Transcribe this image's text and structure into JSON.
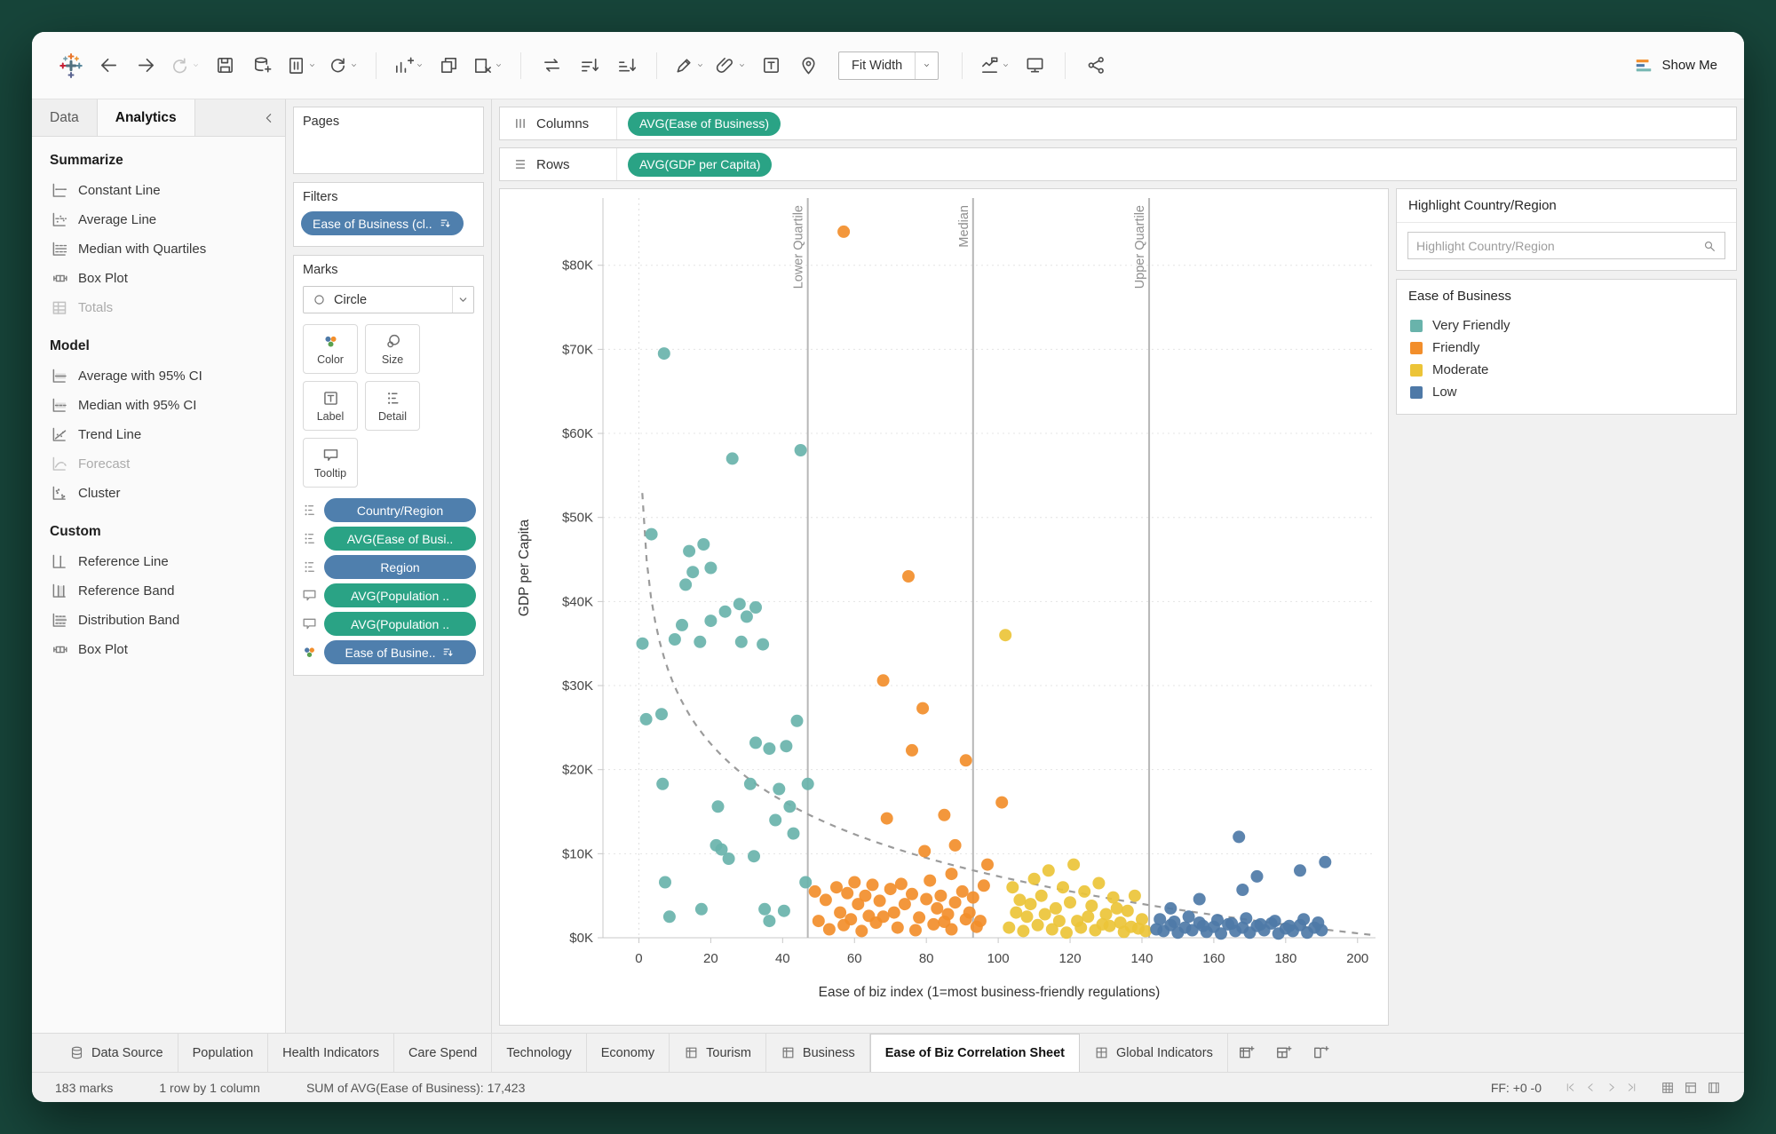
{
  "colors": {
    "desktop": "#17453a",
    "pill_green": "#2aa385",
    "pill_blue": "#4f7fad"
  },
  "toolbar": {
    "fit_label": "Fit Width",
    "show_me_label": "Show Me",
    "items": [
      {
        "type": "btn",
        "icon": "tableau-logo",
        "logo": true
      },
      {
        "type": "btn",
        "icon": "back"
      },
      {
        "type": "btn",
        "icon": "forward"
      },
      {
        "type": "btn",
        "icon": "redo",
        "caret": true,
        "disabled": true
      },
      {
        "type": "btn",
        "icon": "save"
      },
      {
        "type": "btn",
        "icon": "add-data"
      },
      {
        "type": "btn",
        "icon": "pause-updates",
        "caret": true
      },
      {
        "type": "btn",
        "icon": "refresh",
        "caret": true
      },
      {
        "type": "sep"
      },
      {
        "type": "btn",
        "icon": "new-sheet",
        "caret": true
      },
      {
        "type": "btn",
        "icon": "duplicate"
      },
      {
        "type": "btn",
        "icon": "clear-sheet",
        "caret": true
      },
      {
        "type": "sep"
      },
      {
        "type": "btn",
        "icon": "swap-axes"
      },
      {
        "type": "btn",
        "icon": "sort-asc"
      },
      {
        "type": "btn",
        "icon": "sort-desc"
      },
      {
        "type": "sep"
      },
      {
        "type": "btn",
        "icon": "highlight",
        "caret": true
      },
      {
        "type": "btn",
        "icon": "group-members",
        "caret": true
      },
      {
        "type": "btn",
        "icon": "show-labels"
      },
      {
        "type": "btn",
        "icon": "pin"
      },
      {
        "type": "fit"
      },
      {
        "type": "sep"
      },
      {
        "type": "btn",
        "icon": "chart-labels",
        "caret": true
      },
      {
        "type": "btn",
        "icon": "presentation"
      },
      {
        "type": "sep"
      },
      {
        "type": "btn",
        "icon": "share"
      }
    ]
  },
  "left_panel": {
    "tabs": [
      {
        "label": "Data"
      },
      {
        "label": "Analytics"
      }
    ],
    "active_tab": "Analytics",
    "sections": [
      {
        "title": "Summarize",
        "items": [
          {
            "label": "Constant Line",
            "icon": "constant-line"
          },
          {
            "label": "Average Line",
            "icon": "average-line"
          },
          {
            "label": "Median with Quartiles",
            "icon": "median-quartiles"
          },
          {
            "label": "Box Plot",
            "icon": "box-plot"
          },
          {
            "label": "Totals",
            "icon": "totals",
            "disabled": true
          }
        ]
      },
      {
        "title": "Model",
        "items": [
          {
            "label": "Average with 95% CI",
            "icon": "average-ci"
          },
          {
            "label": "Median with 95% CI",
            "icon": "median-ci"
          },
          {
            "label": "Trend Line",
            "icon": "trend-line"
          },
          {
            "label": "Forecast",
            "icon": "forecast",
            "disabled": true
          },
          {
            "label": "Cluster",
            "icon": "cluster"
          }
        ]
      },
      {
        "title": "Custom",
        "items": [
          {
            "label": "Reference Line",
            "icon": "reference-line"
          },
          {
            "label": "Reference Band",
            "icon": "reference-band"
          },
          {
            "label": "Distribution Band",
            "icon": "distribution-band"
          },
          {
            "label": "Box Plot",
            "icon": "box-plot"
          }
        ]
      }
    ]
  },
  "shelves": {
    "pages_label": "Pages",
    "filters_label": "Filters",
    "filter_pills": [
      {
        "label": "Ease of Business (cl..",
        "color": "blue",
        "trailing_icon": "legend"
      }
    ],
    "marks_label": "Marks",
    "mark_type": "Circle",
    "mark_buttons": [
      {
        "label": "Color",
        "icon": "color"
      },
      {
        "label": "Size",
        "icon": "size"
      },
      {
        "label": "Label",
        "icon": "label"
      },
      {
        "label": "Detail",
        "icon": "detail"
      },
      {
        "label": "Tooltip",
        "icon": "tooltip"
      }
    ],
    "mark_pills": [
      {
        "label": "Country/Region",
        "color": "blue",
        "icon": "detail"
      },
      {
        "label": "AVG(Ease of Busi..",
        "color": "green",
        "icon": "detail"
      },
      {
        "label": "Region",
        "color": "blue",
        "icon": "detail"
      },
      {
        "label": "AVG(Population ..",
        "color": "green",
        "icon": "tooltip"
      },
      {
        "label": "AVG(Population ..",
        "color": "green",
        "icon": "tooltip"
      },
      {
        "label": "Ease of Busine..",
        "color": "blue",
        "icon": "color",
        "trailing_icon": "legend"
      }
    ],
    "columns_label": "Columns",
    "columns_pills": [
      {
        "label": "AVG(Ease of Business)",
        "color": "green"
      }
    ],
    "rows_label": "Rows",
    "rows_pills": [
      {
        "label": "AVG(GDP per Capita)",
        "color": "green"
      }
    ]
  },
  "chart_data": {
    "type": "scatter",
    "title": "",
    "xlabel": "Ease of biz index (1=most business-friendly regulations)",
    "ylabel": "GDP per Capita",
    "xlim": [
      -10,
      205
    ],
    "ylim": [
      0,
      88
    ],
    "x_ticks": [
      0,
      20,
      40,
      60,
      80,
      100,
      120,
      140,
      160,
      180,
      200
    ],
    "y_ticks": [
      0,
      10,
      20,
      30,
      40,
      50,
      60,
      70,
      80
    ],
    "y_tick_labels": [
      "$0K",
      "$10K",
      "$20K",
      "$30K",
      "$40K",
      "$50K",
      "$60K",
      "$70K",
      "$80K"
    ],
    "grid": "dotted-horizontal",
    "total_marks": 183,
    "reference_lines": [
      {
        "x": 47,
        "label": "Lower Quartile"
      },
      {
        "x": 93,
        "label": "Median"
      },
      {
        "x": 142,
        "label": "Upper Quartile"
      }
    ],
    "trend_line": {
      "style": "dashed",
      "model": "y = 52.4 - 9.79*ln(x)",
      "a": 52.4,
      "b": -9.79,
      "x_start": 0.95,
      "x_end": 204
    },
    "series": [
      {
        "name": "Very Friendly",
        "color": "#69b3ab",
        "points": [
          [
            7,
            69.5
          ],
          [
            26,
            57
          ],
          [
            45,
            58
          ],
          [
            3.5,
            48
          ],
          [
            14,
            46
          ],
          [
            15,
            43.5
          ],
          [
            13,
            42
          ],
          [
            20,
            44
          ],
          [
            1,
            35
          ],
          [
            10,
            35.5
          ],
          [
            17,
            35.2
          ],
          [
            20,
            37.7
          ],
          [
            24,
            38.8
          ],
          [
            28,
            39.7
          ],
          [
            30,
            38.2
          ],
          [
            32.5,
            39.3
          ],
          [
            28.5,
            35.2
          ],
          [
            34.5,
            34.9
          ],
          [
            6.3,
            26.6
          ],
          [
            2,
            26
          ],
          [
            6.6,
            18.3
          ],
          [
            32.5,
            23.2
          ],
          [
            36.3,
            22.5
          ],
          [
            31,
            18.3
          ],
          [
            39,
            17.7
          ],
          [
            47,
            18.3
          ],
          [
            22,
            15.6
          ],
          [
            42,
            15.6
          ],
          [
            43,
            12.4
          ],
          [
            21.5,
            11
          ],
          [
            25,
            9.4
          ],
          [
            32,
            9.7
          ],
          [
            7.3,
            6.6
          ],
          [
            17.4,
            3.4
          ],
          [
            8.5,
            2.5
          ],
          [
            35,
            3.4
          ],
          [
            40.4,
            3.2
          ],
          [
            36.3,
            2
          ],
          [
            46.4,
            6.6
          ],
          [
            23,
            10.5
          ],
          [
            38,
            14
          ],
          [
            44,
            25.8
          ],
          [
            41,
            22.8
          ],
          [
            12,
            37.2
          ],
          [
            18,
            46.8
          ]
        ]
      },
      {
        "name": "Friendly",
        "color": "#f28e2b",
        "points": [
          [
            57,
            84
          ],
          [
            75,
            43
          ],
          [
            68,
            30.6
          ],
          [
            79,
            27.3
          ],
          [
            76,
            22.3
          ],
          [
            91,
            21.1
          ],
          [
            85,
            14.6
          ],
          [
            101,
            16.1
          ],
          [
            69,
            14.2
          ],
          [
            79.5,
            10.3
          ],
          [
            88,
            11
          ],
          [
            97,
            8.7
          ],
          [
            87,
            7.6
          ],
          [
            49,
            5.5
          ],
          [
            52,
            4.5
          ],
          [
            55,
            6
          ],
          [
            56,
            3
          ],
          [
            58,
            5.3
          ],
          [
            60,
            6.6
          ],
          [
            61,
            4
          ],
          [
            63,
            5
          ],
          [
            64,
            2.6
          ],
          [
            65,
            6.3
          ],
          [
            67,
            4.4
          ],
          [
            70,
            5.8
          ],
          [
            71,
            3
          ],
          [
            73,
            6.4
          ],
          [
            74,
            4
          ],
          [
            76,
            5.2
          ],
          [
            78,
            2.4
          ],
          [
            80,
            4.6
          ],
          [
            81,
            6.8
          ],
          [
            83,
            3.5
          ],
          [
            84,
            5
          ],
          [
            86,
            2.8
          ],
          [
            88,
            4.2
          ],
          [
            90,
            5.5
          ],
          [
            92,
            3
          ],
          [
            93,
            4.8
          ],
          [
            95,
            2
          ],
          [
            50,
            2
          ],
          [
            53,
            1
          ],
          [
            57,
            1.5
          ],
          [
            62,
            0.8
          ],
          [
            66,
            1.8
          ],
          [
            72,
            1.2
          ],
          [
            77,
            0.9
          ],
          [
            82,
            1.6
          ],
          [
            87,
            1
          ],
          [
            91,
            2.2
          ],
          [
            94,
            1.3
          ],
          [
            59,
            2.2
          ],
          [
            68,
            2.5
          ],
          [
            85,
            1.9
          ],
          [
            96,
            6.2
          ]
        ]
      },
      {
        "name": "Moderate",
        "color": "#ecc438",
        "points": [
          [
            102,
            36
          ],
          [
            104,
            6
          ],
          [
            106,
            4.5
          ],
          [
            108,
            2.5
          ],
          [
            110,
            7
          ],
          [
            112,
            5
          ],
          [
            114,
            8
          ],
          [
            116,
            3.5
          ],
          [
            118,
            6
          ],
          [
            120,
            4.2
          ],
          [
            121,
            8.7
          ],
          [
            122,
            2
          ],
          [
            124,
            5.5
          ],
          [
            126,
            3.8
          ],
          [
            128,
            6.5
          ],
          [
            130,
            2.8
          ],
          [
            132,
            4.8
          ],
          [
            134,
            1.8
          ],
          [
            136,
            3.2
          ],
          [
            138,
            5
          ],
          [
            140,
            2.2
          ],
          [
            103,
            1.2
          ],
          [
            107,
            0.8
          ],
          [
            111,
            1.5
          ],
          [
            115,
            1
          ],
          [
            119,
            0.6
          ],
          [
            123,
            1.2
          ],
          [
            127,
            0.9
          ],
          [
            131,
            1.4
          ],
          [
            135,
            0.7
          ],
          [
            139,
            1.1
          ],
          [
            105,
            3
          ],
          [
            109,
            4
          ],
          [
            113,
            2.8
          ],
          [
            117,
            2
          ],
          [
            125,
            2.5
          ],
          [
            129,
            1.6
          ],
          [
            133,
            3.5
          ],
          [
            137,
            1.3
          ],
          [
            141,
            0.8
          ]
        ]
      },
      {
        "name": "Low",
        "color": "#4e79a7",
        "points": [
          [
            167,
            12
          ],
          [
            172,
            7.3
          ],
          [
            184,
            8
          ],
          [
            191,
            9
          ],
          [
            168,
            5.7
          ],
          [
            156,
            4.6
          ],
          [
            144,
            1
          ],
          [
            146,
            0.8
          ],
          [
            148,
            1.5
          ],
          [
            150,
            0.6
          ],
          [
            152,
            1.2
          ],
          [
            154,
            0.9
          ],
          [
            156,
            1.8
          ],
          [
            158,
            0.7
          ],
          [
            160,
            1.3
          ],
          [
            162,
            0.5
          ],
          [
            164,
            1.6
          ],
          [
            166,
            0.8
          ],
          [
            168,
            1.2
          ],
          [
            170,
            0.6
          ],
          [
            172,
            1.4
          ],
          [
            174,
            0.9
          ],
          [
            176,
            1.7
          ],
          [
            178,
            0.5
          ],
          [
            180,
            1.1
          ],
          [
            182,
            0.8
          ],
          [
            184,
            1.5
          ],
          [
            186,
            0.6
          ],
          [
            188,
            1.2
          ],
          [
            190,
            0.9
          ],
          [
            145,
            2.2
          ],
          [
            149,
            1.9
          ],
          [
            153,
            2.5
          ],
          [
            157,
            1.4
          ],
          [
            161,
            2.1
          ],
          [
            165,
            1.7
          ],
          [
            169,
            2.3
          ],
          [
            173,
            1.6
          ],
          [
            177,
            2
          ],
          [
            181,
            1.4
          ],
          [
            185,
            2.2
          ],
          [
            189,
            1.8
          ],
          [
            148,
            3.5
          ]
        ]
      }
    ]
  },
  "right_panel": {
    "highlight_title": "Highlight Country/Region",
    "search_placeholder": "Highlight Country/Region",
    "search_value": "",
    "legend_title": "Ease of Business",
    "legend_items": [
      {
        "label": "Very Friendly",
        "color": "#69b3ab"
      },
      {
        "label": "Friendly",
        "color": "#f28e2b"
      },
      {
        "label": "Moderate",
        "color": "#ecc438"
      },
      {
        "label": "Low",
        "color": "#4e79a7"
      }
    ]
  },
  "sheet_tabs": {
    "tabs": [
      {
        "label": "Data Source",
        "icon": "data-source"
      },
      {
        "label": "Population"
      },
      {
        "label": "Health Indicators"
      },
      {
        "label": "Care Spend"
      },
      {
        "label": "Technology"
      },
      {
        "label": "Economy"
      },
      {
        "label": "Tourism",
        "icon": "worksheet"
      },
      {
        "label": "Business",
        "icon": "worksheet"
      },
      {
        "label": "Ease of Biz Correlation Sheet",
        "active": true
      },
      {
        "label": "Global Indicators",
        "icon": "dashboard"
      }
    ]
  },
  "status_bar": {
    "marks": "183 marks",
    "dimensions": "1 row by 1 column",
    "aggregate": "SUM of AVG(Ease of Business): 17,423",
    "ff": "FF: +0 -0"
  }
}
